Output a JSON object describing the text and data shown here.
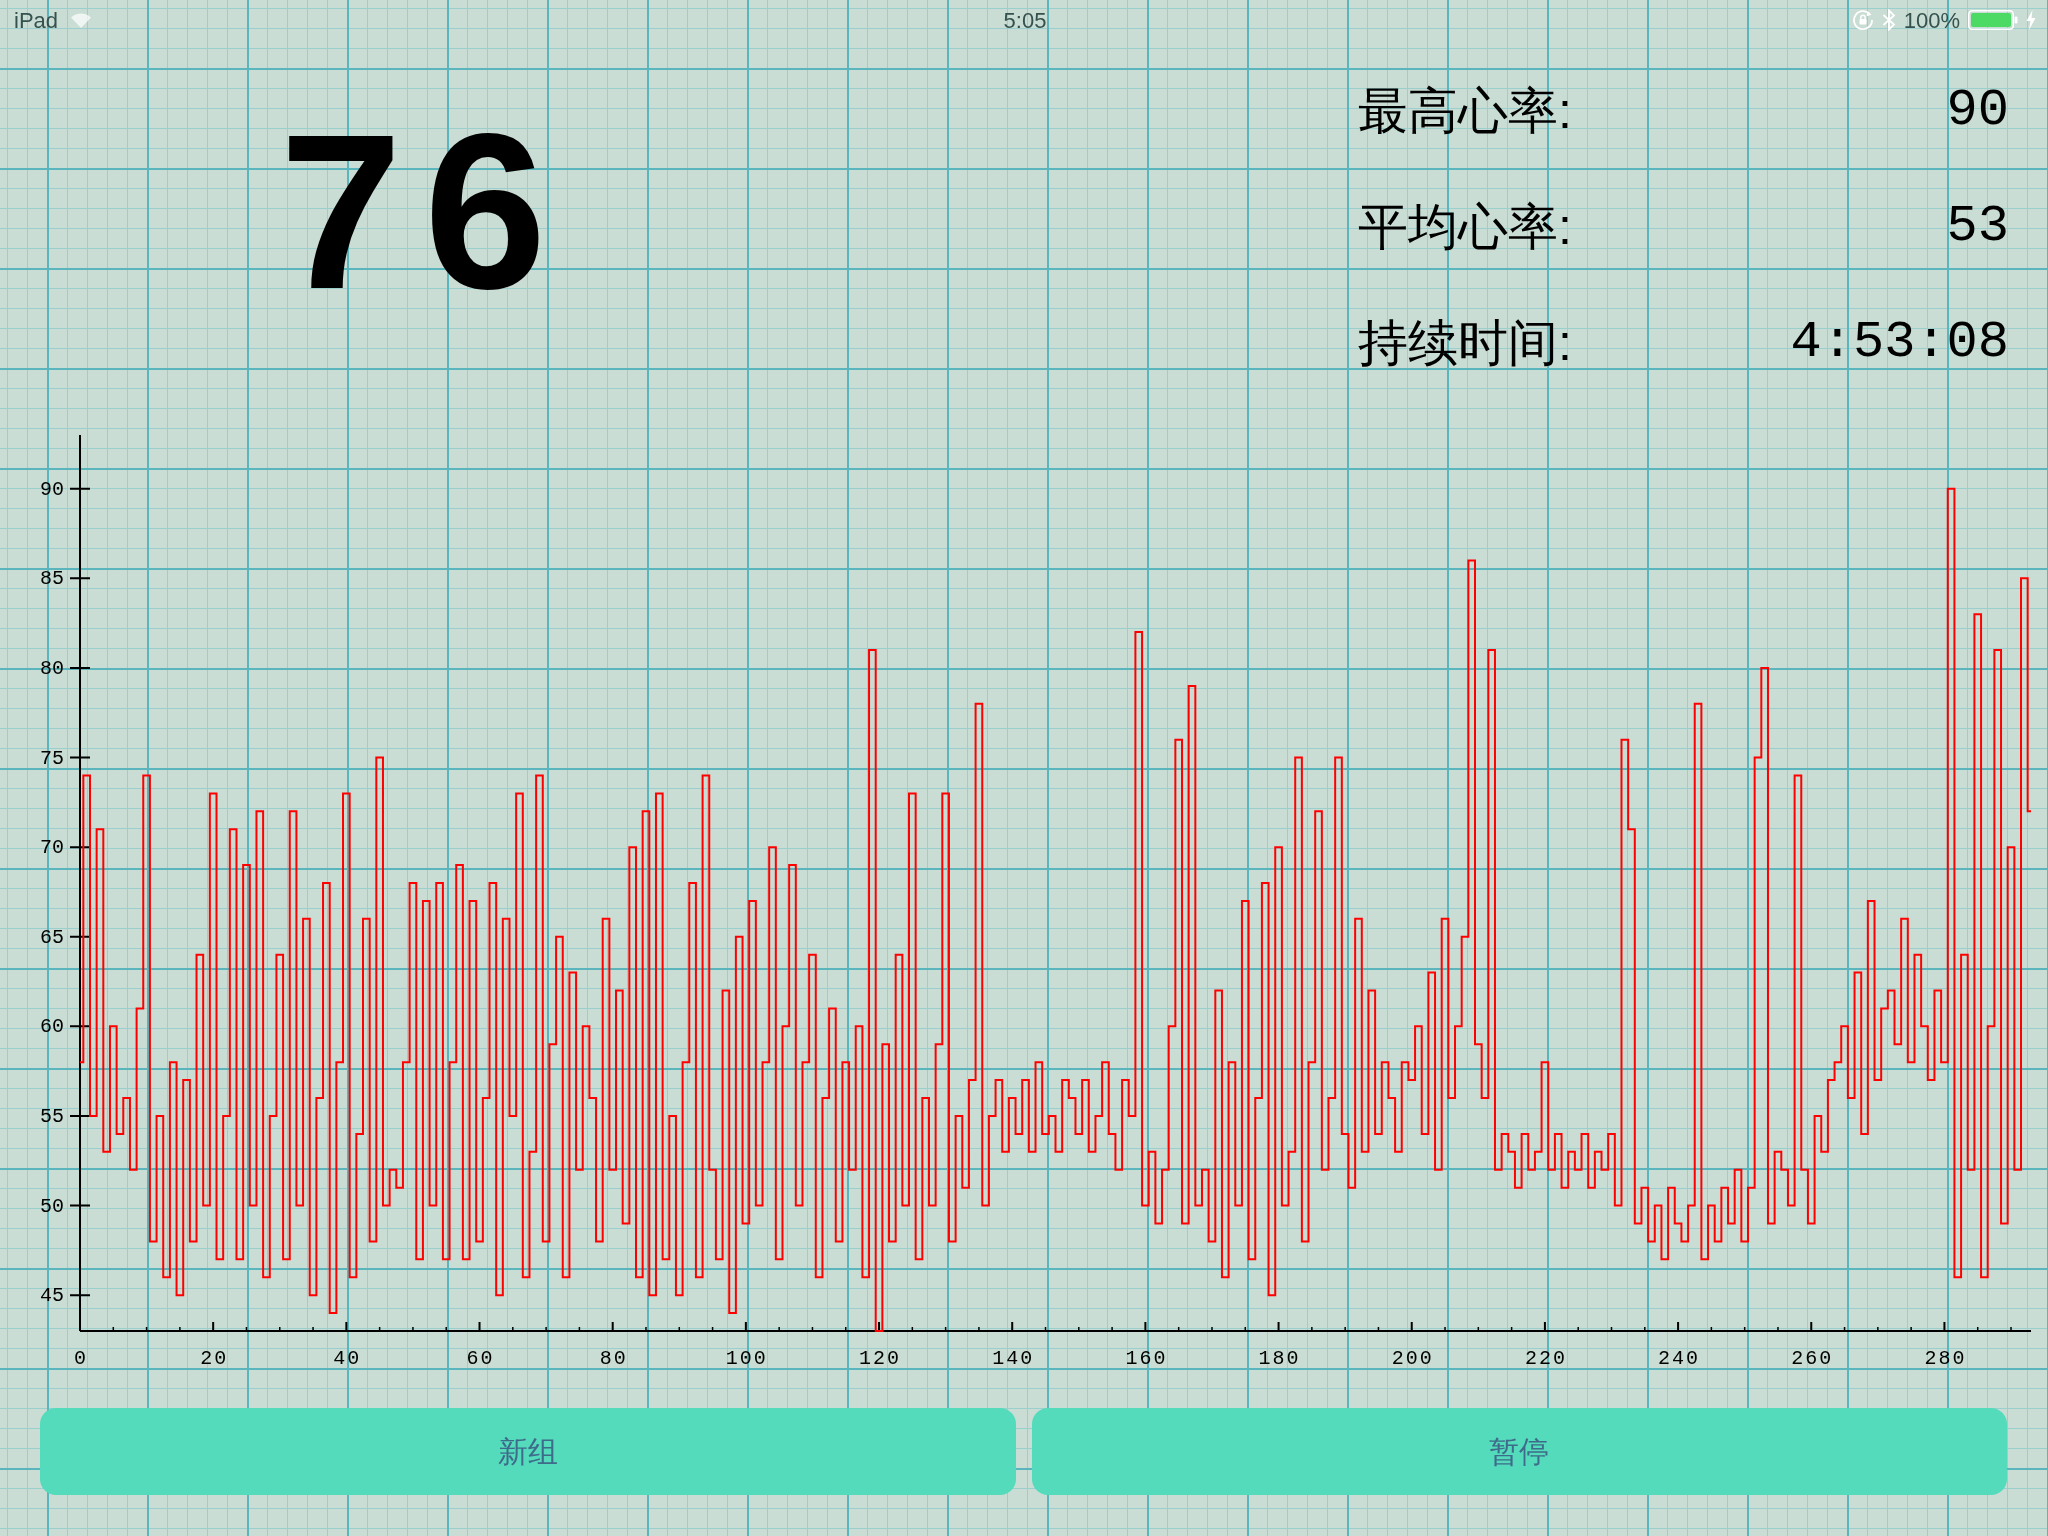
{
  "status_bar": {
    "device": "iPad",
    "time": "5:05",
    "battery": "100%"
  },
  "current_heart_rate": "76",
  "stats": [
    {
      "label": "最高心率:",
      "value": "90"
    },
    {
      "label": "平均心率:",
      "value": "53"
    },
    {
      "label": "持续时间:",
      "value": "4:53:08"
    }
  ],
  "chart": {
    "chart_data": {
      "type": "line",
      "x": [
        0,
        1,
        2,
        3,
        4,
        5,
        6,
        7,
        8,
        9,
        10,
        11,
        12,
        13,
        14,
        15,
        16,
        17,
        18,
        19,
        20,
        21,
        22,
        23,
        24,
        25,
        26,
        27,
        28,
        29,
        30,
        31,
        32,
        33,
        34,
        35,
        36,
        37,
        38,
        39,
        40,
        41,
        42,
        43,
        44,
        45,
        46,
        47,
        48,
        49,
        50,
        51,
        52,
        53,
        54,
        55,
        56,
        57,
        58,
        59,
        60,
        61,
        62,
        63,
        64,
        65,
        66,
        67,
        68,
        69,
        70,
        71,
        72,
        73,
        74,
        75,
        76,
        77,
        78,
        79,
        80,
        81,
        82,
        83,
        84,
        85,
        86,
        87,
        88,
        89,
        90,
        91,
        92,
        93,
        94,
        95,
        96,
        97,
        98,
        99,
        100,
        101,
        102,
        103,
        104,
        105,
        106,
        107,
        108,
        109,
        110,
        111,
        112,
        113,
        114,
        115,
        116,
        117,
        118,
        119,
        120,
        121,
        122,
        123,
        124,
        125,
        126,
        127,
        128,
        129,
        130,
        131,
        132,
        133,
        134,
        135,
        136,
        137,
        138,
        139,
        140,
        141,
        142,
        143,
        144,
        145,
        146,
        147,
        148,
        149,
        150,
        151,
        152,
        153,
        154,
        155,
        156,
        157,
        158,
        159,
        160,
        161,
        162,
        163,
        164,
        165,
        166,
        167,
        168,
        169,
        170,
        171,
        172,
        173,
        174,
        175,
        176,
        177,
        178,
        179,
        180,
        181,
        182,
        183,
        184,
        185,
        186,
        187,
        188,
        189,
        190,
        191,
        192,
        193,
        194,
        195,
        196,
        197,
        198,
        199,
        200,
        201,
        202,
        203,
        204,
        205,
        206,
        207,
        208,
        209,
        210,
        211,
        212,
        213,
        214,
        215,
        216,
        217,
        218,
        219,
        220,
        221,
        222,
        223,
        224,
        225,
        226,
        227,
        228,
        229,
        230,
        231,
        232,
        233,
        234,
        235,
        236,
        237,
        238,
        239,
        240,
        241,
        242,
        243,
        244,
        245,
        246,
        247,
        248,
        249,
        250,
        251,
        252,
        253,
        254,
        255,
        256,
        257,
        258,
        259,
        260,
        261,
        262,
        263,
        264,
        265,
        266,
        267,
        268,
        269,
        270,
        271,
        272,
        273,
        274,
        275,
        276,
        277,
        278,
        279,
        280,
        281,
        282,
        283,
        284,
        285,
        286,
        287,
        288,
        289,
        290,
        291,
        292,
        293
      ],
      "series": [
        {
          "color": "#ff0000",
          "values": [
            58,
            74,
            55,
            71,
            53,
            60,
            54,
            56,
            52,
            61,
            74,
            48,
            55,
            46,
            58,
            45,
            57,
            48,
            64,
            50,
            73,
            47,
            55,
            71,
            47,
            69,
            50,
            72,
            46,
            55,
            64,
            47,
            72,
            50,
            66,
            45,
            56,
            68,
            44,
            58,
            73,
            46,
            54,
            66,
            48,
            75,
            50,
            52,
            51,
            58,
            68,
            47,
            67,
            50,
            68,
            47,
            58,
            69,
            47,
            67,
            48,
            56,
            68,
            45,
            66,
            55,
            73,
            46,
            53,
            74,
            48,
            59,
            65,
            46,
            63,
            52,
            60,
            56,
            48,
            66,
            52,
            62,
            49,
            70,
            46,
            72,
            45,
            73,
            47,
            55,
            45,
            58,
            68,
            46,
            74,
            52,
            47,
            62,
            44,
            65,
            49,
            67,
            50,
            58,
            70,
            47,
            60,
            69,
            50,
            58,
            64,
            46,
            56,
            61,
            48,
            58,
            52,
            60,
            46,
            81,
            43,
            59,
            48,
            64,
            50,
            73,
            47,
            56,
            50,
            59,
            73,
            48,
            55,
            51,
            57,
            78,
            50,
            55,
            57,
            53,
            56,
            54,
            57,
            53,
            58,
            54,
            55,
            53,
            57,
            56,
            54,
            57,
            53,
            55,
            58,
            54,
            52,
            57,
            55,
            82,
            50,
            53,
            49,
            52,
            60,
            76,
            49,
            79,
            50,
            52,
            48,
            62,
            46,
            58,
            50,
            67,
            47,
            56,
            68,
            45,
            70,
            50,
            53,
            75,
            48,
            58,
            72,
            52,
            56,
            75,
            54,
            51,
            66,
            53,
            62,
            54,
            58,
            56,
            53,
            58,
            57,
            60,
            54,
            63,
            52,
            66,
            56,
            60,
            65,
            86,
            59,
            56,
            81,
            52,
            54,
            53,
            51,
            54,
            52,
            53,
            58,
            52,
            54,
            51,
            53,
            52,
            54,
            51,
            53,
            52,
            54,
            50,
            76,
            71,
            49,
            51,
            48,
            50,
            47,
            51,
            49,
            48,
            50,
            78,
            47,
            50,
            48,
            51,
            49,
            52,
            48,
            51,
            75,
            80,
            49,
            53,
            52,
            50,
            74,
            52,
            49,
            55,
            53,
            57,
            58,
            60,
            56,
            63,
            54,
            67,
            57,
            61,
            62,
            59,
            66,
            58,
            64,
            60,
            57,
            62,
            58,
            90,
            46,
            64,
            52,
            83,
            46,
            60,
            81,
            49,
            70,
            52,
            85,
            72
          ]
        }
      ],
      "xlim": [
        0,
        293
      ],
      "ylim": [
        43,
        93
      ],
      "xticks": [
        0,
        20,
        40,
        60,
        80,
        100,
        120,
        140,
        160,
        180,
        200,
        220,
        240,
        260,
        280
      ],
      "yticks": [
        45,
        50,
        55,
        60,
        65,
        70,
        75,
        80,
        85,
        90
      ]
    }
  },
  "buttons": [
    {
      "label": "新组"
    },
    {
      "label": "暂停"
    }
  ]
}
